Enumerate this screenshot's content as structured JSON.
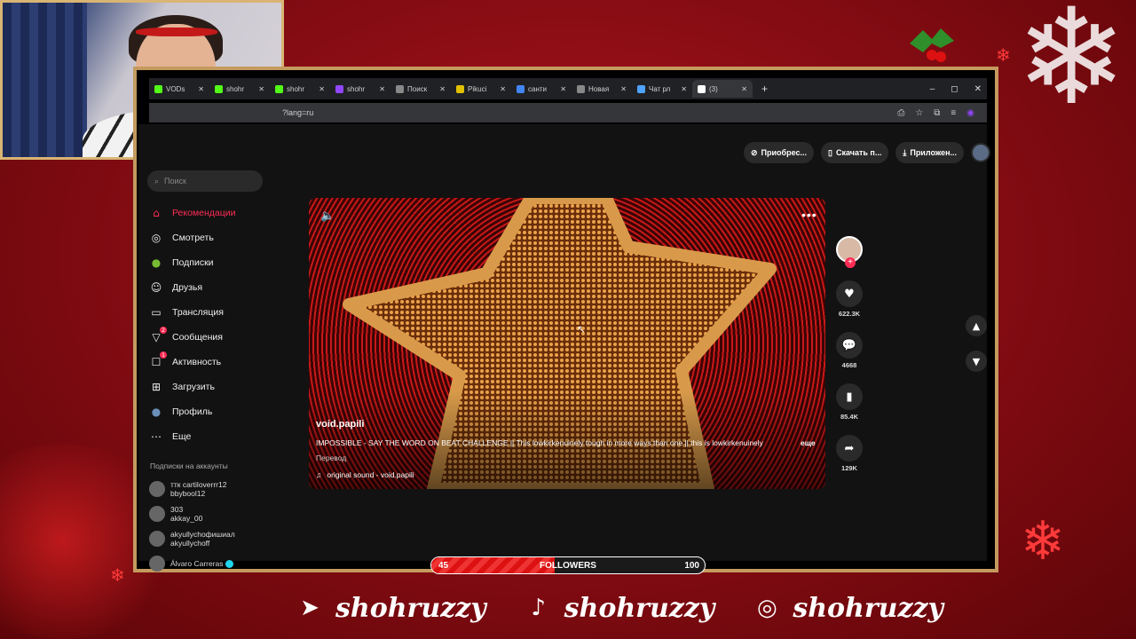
{
  "browser": {
    "tabs": [
      {
        "label": "VODs",
        "color": "#53fc18"
      },
      {
        "label": "shohr",
        "color": "#53fc18"
      },
      {
        "label": "shohr",
        "color": "#53fc18"
      },
      {
        "label": "shohr",
        "color": "#9146ff"
      },
      {
        "label": "Поиск",
        "color": "#888888"
      },
      {
        "label": "Pikuci",
        "color": "#e0c000"
      },
      {
        "label": "санти",
        "color": "#4285f4"
      },
      {
        "label": "Новая",
        "color": "#888888"
      },
      {
        "label": "Чат рл",
        "color": "#4ea3ff"
      },
      {
        "label": "(3)",
        "color": "#ffffff"
      }
    ],
    "new_tab": "+",
    "url": "?lang=ru",
    "win_min": "–",
    "win_max": "◻",
    "win_close": "✕"
  },
  "header": {
    "buy_label": "Приобрес...",
    "download_label": "Скачать п...",
    "apps_label": "Приложен..."
  },
  "sidebar": {
    "search_placeholder": "Поиск",
    "items": [
      {
        "label": "Рекомендации",
        "icon": "⌂"
      },
      {
        "label": "Смотреть",
        "icon": "◎"
      },
      {
        "label": "Подписки",
        "icon": "●"
      },
      {
        "label": "Друзья",
        "icon": "☺"
      },
      {
        "label": "Трансляция",
        "icon": "▭"
      },
      {
        "label": "Сообщения",
        "icon": "▽",
        "badge": "2"
      },
      {
        "label": "Активность",
        "icon": "☐",
        "badge": "1"
      },
      {
        "label": "Загрузить",
        "icon": "⊞"
      },
      {
        "label": "Профиль",
        "icon": "●"
      },
      {
        "label": "Еще",
        "icon": "⋯"
      }
    ],
    "subs_title": "Подписки на аккаунты",
    "subs": [
      {
        "line1": "ттк cartiloverrr12",
        "line2": "bbybool12"
      },
      {
        "line1": "303",
        "line2": "akkay_00"
      },
      {
        "line1": "akyullychoфишиал",
        "line2": "akyullychoff"
      },
      {
        "line1": "Álvaro Carreras",
        "line2": ""
      }
    ]
  },
  "video": {
    "username": "void.papili",
    "description": "IMPOSSIBLE - SAY THE WORD ON BEAT CHALLENGE || This lowkirkenuinely tough in more ways than one || this is lowkirkenuinely",
    "more": "еще",
    "translate": "Перевод",
    "sound": "original sound - void.papili",
    "likes": "622.3K",
    "comments": "4668",
    "saves": "85.4K",
    "shares": "129K"
  },
  "followers_goal": {
    "current": "45",
    "label": "FOLLOWERS",
    "goal": "100",
    "progress": 0.45
  },
  "socials": [
    {
      "icon": "telegram-icon",
      "handle": "shohruzzy"
    },
    {
      "icon": "tiktok-icon",
      "handle": "shohruzzy"
    },
    {
      "icon": "instagram-icon",
      "handle": "shohruzzy"
    }
  ],
  "colors": {
    "accent": "#fe2c55",
    "frame": "#c49a5e",
    "background": "#8a0d14"
  }
}
